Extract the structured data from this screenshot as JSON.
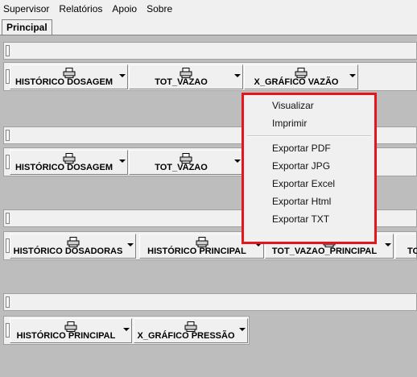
{
  "menubar": {
    "items": [
      "Supervisor",
      "Relatórios",
      "Apoio",
      "Sobre"
    ]
  },
  "tabs": [
    {
      "label": "Principal"
    }
  ],
  "toolbars": [
    {
      "buttons": [
        "HISTÓRICO DOSAGEM",
        "TOT_VAZAO",
        "X_GRÁFICO VAZÃO"
      ]
    },
    {
      "buttons": [
        "HISTÓRICO DOSAGEM",
        "TOT_VAZAO"
      ]
    },
    {
      "buttons": [
        "HISTÓRICO DOSADORAS",
        "HISTÓRICO PRINCIPAL",
        "TOT_VAZAO_PRINCIPAL",
        "TO"
      ]
    },
    {
      "buttons": [
        "HISTÓRICO PRINCIPAL",
        "X_GRÁFICO PRESSÃO"
      ]
    }
  ],
  "dropdown_menu": {
    "items": [
      "Visualizar",
      "Imprimir",
      "Exportar PDF",
      "Exportar JPG",
      "Exportar Excel",
      "Exportar Html",
      "Exportar TXT"
    ],
    "highlight_color": "#e8141b"
  },
  "icons": {
    "button_icon": "printer-icon",
    "dropdown_icon": "chevron-down-icon"
  }
}
